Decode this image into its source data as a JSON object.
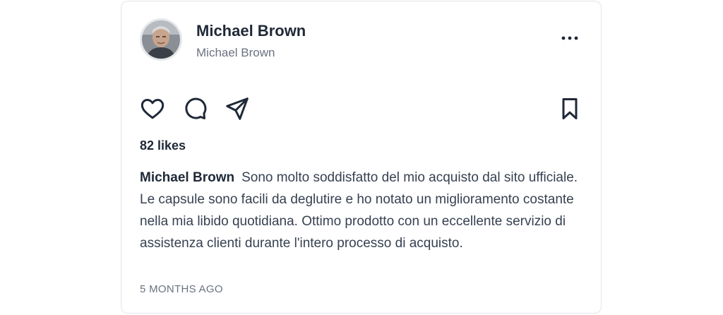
{
  "post": {
    "user": {
      "name": "Michael Brown",
      "handle": "Michael Brown"
    },
    "likes": "82 likes",
    "caption": {
      "author": "Michael Brown",
      "text": "Sono molto soddisfatto del mio acquisto dal sito ufficiale. Le capsule sono facili da deglutire e ho notato un miglioramento costante nella mia libido quotidiana. Ottimo prodotto con un eccellente servizio di assistenza clienti durante l'intero processo di acquisto."
    },
    "timestamp": "5 MONTHS AGO"
  },
  "icons": {
    "avatar": "user-photo",
    "more": "more-horizontal-icon",
    "like": "heart-icon",
    "comment": "comment-icon",
    "share": "send-icon",
    "save": "bookmark-icon"
  },
  "colors": {
    "text_primary": "#1f2937",
    "text_secondary": "#6b7280",
    "border": "#e2e4e8"
  }
}
